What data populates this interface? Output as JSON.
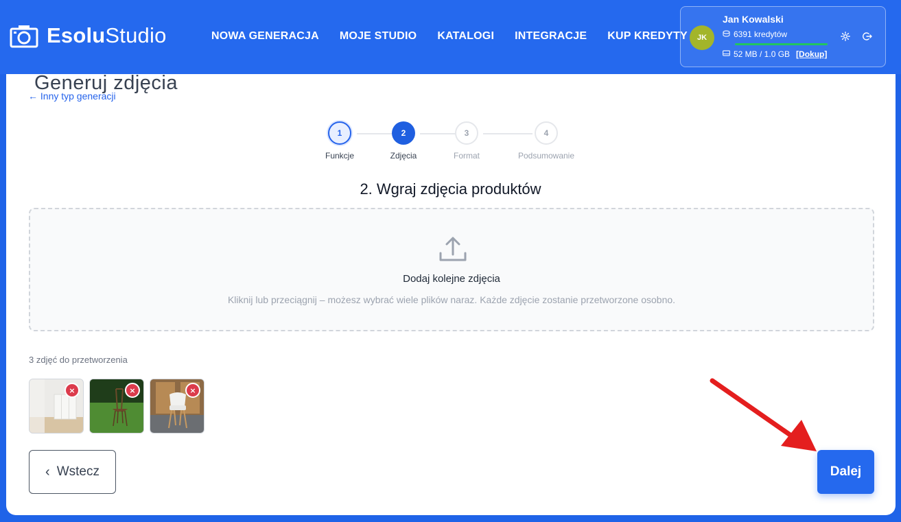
{
  "app": {
    "logo_bold": "Esolu",
    "logo_light": "Studio"
  },
  "nav": {
    "items": [
      "NOWA GENERACJA",
      "MOJE STUDIO",
      "KATALOGI",
      "INTEGRACJE",
      "KUP KREDYTY"
    ]
  },
  "user": {
    "initials": "JK",
    "name": "Jan Kowalski",
    "credits": "6391 kredytów",
    "credits_fill_fraction": 1.0,
    "storage": "52 MB / 1.0 GB",
    "storage_link": "[Dokup]",
    "avatar_color": "#a3b52a"
  },
  "page": {
    "title_behind": "Generuj zdjęcia",
    "back_link": "← Inny typ generacji"
  },
  "stepper": {
    "steps": [
      {
        "number": "1",
        "label": "Funkcje",
        "state": "done"
      },
      {
        "number": "2",
        "label": "Zdjęcia",
        "state": "active"
      },
      {
        "number": "3",
        "label": "Format",
        "state": "todo"
      },
      {
        "number": "4",
        "label": "Podsumowanie",
        "state": "todo"
      }
    ]
  },
  "upload": {
    "section_title": "2. Wgraj zdjęcia produktów",
    "dropzone_title": "Dodaj kolejne zdjęcia",
    "dropzone_hint": "Kliknij lub przeciągnij – możesz wybrać wiele plików naraz. Każde zdjęcie zostanie przetworzone osobno.",
    "count_label": "3 zdjęć do przetworzenia",
    "remove_symbol": "×"
  },
  "actions": {
    "back_label": "Wstecz",
    "back_icon": "‹",
    "next_label": "Dalej"
  },
  "colors": {
    "brand": "#2569ee",
    "background": "#1f63e8",
    "remove": "#dc3b4b",
    "annotation_arrow": "#e41e1e"
  }
}
